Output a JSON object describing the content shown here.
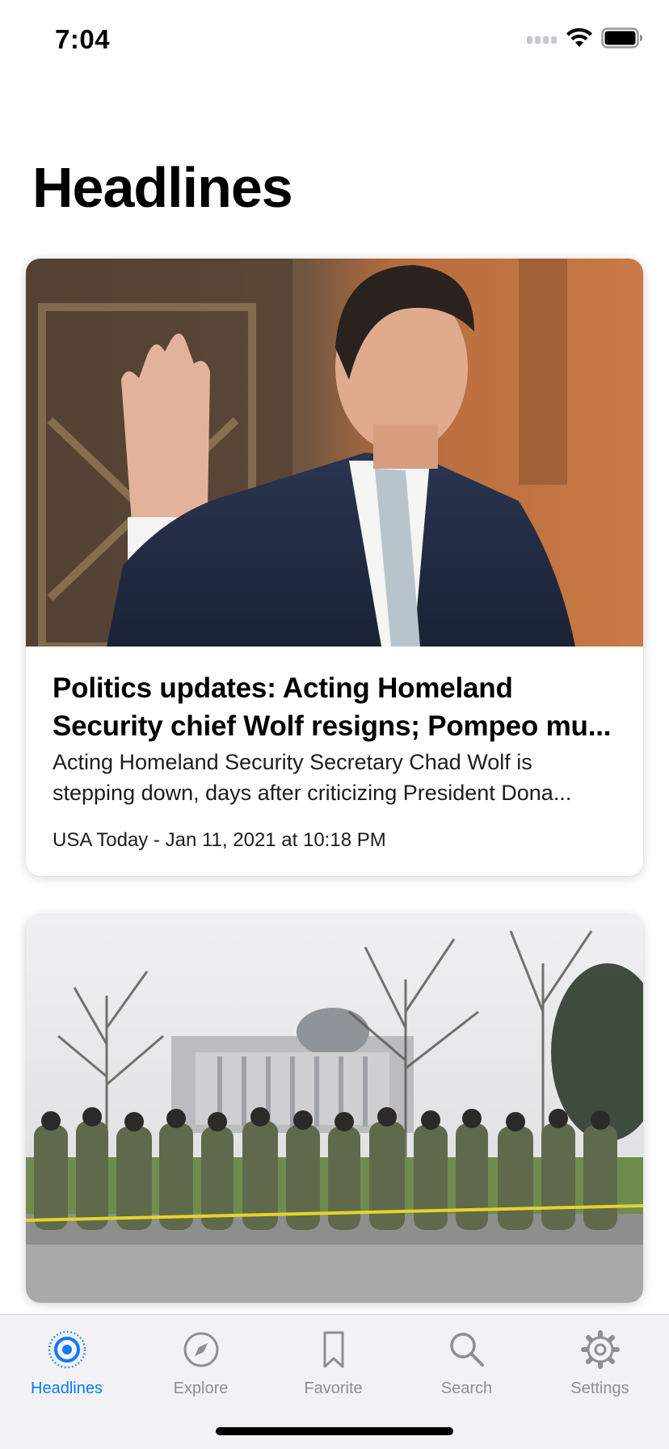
{
  "status_bar": {
    "time": "7:04",
    "icons": [
      "signal-icon",
      "wifi-icon",
      "battery-icon"
    ]
  },
  "page": {
    "title": "Headlines"
  },
  "articles": [
    {
      "image_icon": "news-photo",
      "headline": "Politics updates: Acting Homeland Security chief Wolf resigns; Pompeo mu...",
      "summary": "Acting Homeland Security Secretary Chad Wolf is stepping down, days after criticizing President Dona...",
      "source": "USA Today - Jan 11, 2021 at 10:18 PM"
    },
    {
      "image_icon": "news-photo"
    }
  ],
  "tab_bar": {
    "tabs": [
      {
        "label": "Headlines",
        "icon": "headlines-icon",
        "active": true
      },
      {
        "label": "Explore",
        "icon": "compass-icon",
        "active": false
      },
      {
        "label": "Favorite",
        "icon": "bookmark-icon",
        "active": false
      },
      {
        "label": "Search",
        "icon": "search-icon",
        "active": false
      },
      {
        "label": "Settings",
        "icon": "gear-icon",
        "active": false
      }
    ]
  },
  "colors": {
    "accent": "#0a7aff",
    "inactive_tab": "#8e8e93",
    "tab_bar_bg": "#f2f2f4"
  }
}
